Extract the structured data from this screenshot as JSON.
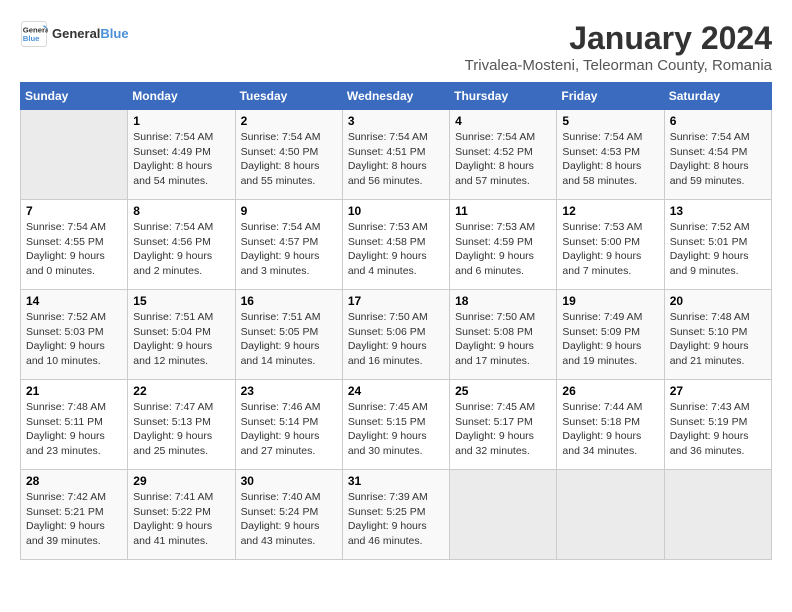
{
  "logo": {
    "general": "General",
    "blue": "Blue"
  },
  "title": "January 2024",
  "location": "Trivalea-Mosteni, Teleorman County, Romania",
  "headers": [
    "Sunday",
    "Monday",
    "Tuesday",
    "Wednesday",
    "Thursday",
    "Friday",
    "Saturday"
  ],
  "weeks": [
    [
      {
        "day": "",
        "sunrise": "",
        "sunset": "",
        "daylight": ""
      },
      {
        "day": "1",
        "sunrise": "Sunrise: 7:54 AM",
        "sunset": "Sunset: 4:49 PM",
        "daylight": "Daylight: 8 hours and 54 minutes."
      },
      {
        "day": "2",
        "sunrise": "Sunrise: 7:54 AM",
        "sunset": "Sunset: 4:50 PM",
        "daylight": "Daylight: 8 hours and 55 minutes."
      },
      {
        "day": "3",
        "sunrise": "Sunrise: 7:54 AM",
        "sunset": "Sunset: 4:51 PM",
        "daylight": "Daylight: 8 hours and 56 minutes."
      },
      {
        "day": "4",
        "sunrise": "Sunrise: 7:54 AM",
        "sunset": "Sunset: 4:52 PM",
        "daylight": "Daylight: 8 hours and 57 minutes."
      },
      {
        "day": "5",
        "sunrise": "Sunrise: 7:54 AM",
        "sunset": "Sunset: 4:53 PM",
        "daylight": "Daylight: 8 hours and 58 minutes."
      },
      {
        "day": "6",
        "sunrise": "Sunrise: 7:54 AM",
        "sunset": "Sunset: 4:54 PM",
        "daylight": "Daylight: 8 hours and 59 minutes."
      }
    ],
    [
      {
        "day": "7",
        "sunrise": "Sunrise: 7:54 AM",
        "sunset": "Sunset: 4:55 PM",
        "daylight": "Daylight: 9 hours and 0 minutes."
      },
      {
        "day": "8",
        "sunrise": "Sunrise: 7:54 AM",
        "sunset": "Sunset: 4:56 PM",
        "daylight": "Daylight: 9 hours and 2 minutes."
      },
      {
        "day": "9",
        "sunrise": "Sunrise: 7:54 AM",
        "sunset": "Sunset: 4:57 PM",
        "daylight": "Daylight: 9 hours and 3 minutes."
      },
      {
        "day": "10",
        "sunrise": "Sunrise: 7:53 AM",
        "sunset": "Sunset: 4:58 PM",
        "daylight": "Daylight: 9 hours and 4 minutes."
      },
      {
        "day": "11",
        "sunrise": "Sunrise: 7:53 AM",
        "sunset": "Sunset: 4:59 PM",
        "daylight": "Daylight: 9 hours and 6 minutes."
      },
      {
        "day": "12",
        "sunrise": "Sunrise: 7:53 AM",
        "sunset": "Sunset: 5:00 PM",
        "daylight": "Daylight: 9 hours and 7 minutes."
      },
      {
        "day": "13",
        "sunrise": "Sunrise: 7:52 AM",
        "sunset": "Sunset: 5:01 PM",
        "daylight": "Daylight: 9 hours and 9 minutes."
      }
    ],
    [
      {
        "day": "14",
        "sunrise": "Sunrise: 7:52 AM",
        "sunset": "Sunset: 5:03 PM",
        "daylight": "Daylight: 9 hours and 10 minutes."
      },
      {
        "day": "15",
        "sunrise": "Sunrise: 7:51 AM",
        "sunset": "Sunset: 5:04 PM",
        "daylight": "Daylight: 9 hours and 12 minutes."
      },
      {
        "day": "16",
        "sunrise": "Sunrise: 7:51 AM",
        "sunset": "Sunset: 5:05 PM",
        "daylight": "Daylight: 9 hours and 14 minutes."
      },
      {
        "day": "17",
        "sunrise": "Sunrise: 7:50 AM",
        "sunset": "Sunset: 5:06 PM",
        "daylight": "Daylight: 9 hours and 16 minutes."
      },
      {
        "day": "18",
        "sunrise": "Sunrise: 7:50 AM",
        "sunset": "Sunset: 5:08 PM",
        "daylight": "Daylight: 9 hours and 17 minutes."
      },
      {
        "day": "19",
        "sunrise": "Sunrise: 7:49 AM",
        "sunset": "Sunset: 5:09 PM",
        "daylight": "Daylight: 9 hours and 19 minutes."
      },
      {
        "day": "20",
        "sunrise": "Sunrise: 7:48 AM",
        "sunset": "Sunset: 5:10 PM",
        "daylight": "Daylight: 9 hours and 21 minutes."
      }
    ],
    [
      {
        "day": "21",
        "sunrise": "Sunrise: 7:48 AM",
        "sunset": "Sunset: 5:11 PM",
        "daylight": "Daylight: 9 hours and 23 minutes."
      },
      {
        "day": "22",
        "sunrise": "Sunrise: 7:47 AM",
        "sunset": "Sunset: 5:13 PM",
        "daylight": "Daylight: 9 hours and 25 minutes."
      },
      {
        "day": "23",
        "sunrise": "Sunrise: 7:46 AM",
        "sunset": "Sunset: 5:14 PM",
        "daylight": "Daylight: 9 hours and 27 minutes."
      },
      {
        "day": "24",
        "sunrise": "Sunrise: 7:45 AM",
        "sunset": "Sunset: 5:15 PM",
        "daylight": "Daylight: 9 hours and 30 minutes."
      },
      {
        "day": "25",
        "sunrise": "Sunrise: 7:45 AM",
        "sunset": "Sunset: 5:17 PM",
        "daylight": "Daylight: 9 hours and 32 minutes."
      },
      {
        "day": "26",
        "sunrise": "Sunrise: 7:44 AM",
        "sunset": "Sunset: 5:18 PM",
        "daylight": "Daylight: 9 hours and 34 minutes."
      },
      {
        "day": "27",
        "sunrise": "Sunrise: 7:43 AM",
        "sunset": "Sunset: 5:19 PM",
        "daylight": "Daylight: 9 hours and 36 minutes."
      }
    ],
    [
      {
        "day": "28",
        "sunrise": "Sunrise: 7:42 AM",
        "sunset": "Sunset: 5:21 PM",
        "daylight": "Daylight: 9 hours and 39 minutes."
      },
      {
        "day": "29",
        "sunrise": "Sunrise: 7:41 AM",
        "sunset": "Sunset: 5:22 PM",
        "daylight": "Daylight: 9 hours and 41 minutes."
      },
      {
        "day": "30",
        "sunrise": "Sunrise: 7:40 AM",
        "sunset": "Sunset: 5:24 PM",
        "daylight": "Daylight: 9 hours and 43 minutes."
      },
      {
        "day": "31",
        "sunrise": "Sunrise: 7:39 AM",
        "sunset": "Sunset: 5:25 PM",
        "daylight": "Daylight: 9 hours and 46 minutes."
      },
      {
        "day": "",
        "sunrise": "",
        "sunset": "",
        "daylight": ""
      },
      {
        "day": "",
        "sunrise": "",
        "sunset": "",
        "daylight": ""
      },
      {
        "day": "",
        "sunrise": "",
        "sunset": "",
        "daylight": ""
      }
    ]
  ]
}
